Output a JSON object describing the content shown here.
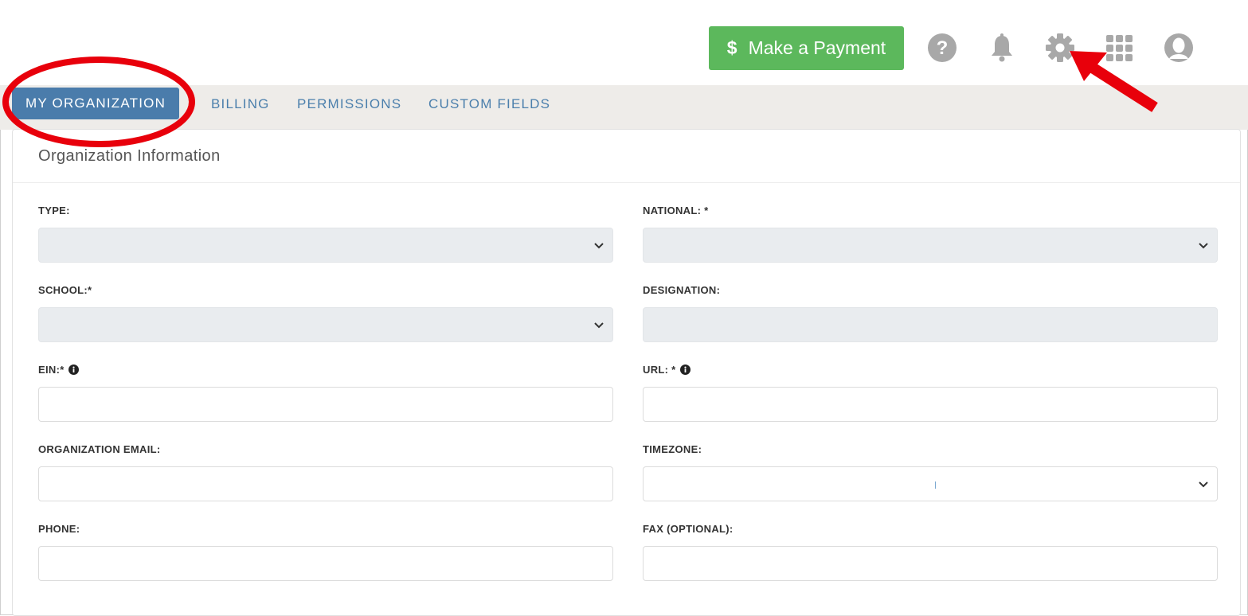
{
  "header": {
    "payment_button": {
      "label": "Make a Payment",
      "icon": "dollar-icon"
    },
    "icons": [
      "help-icon",
      "bell-icon",
      "gear-icon",
      "apps-grid-icon",
      "user-avatar-icon"
    ]
  },
  "tabs": [
    {
      "label": "MY ORGANIZATION",
      "active": true
    },
    {
      "label": "BILLING",
      "active": false
    },
    {
      "label": "PERMISSIONS",
      "active": false
    },
    {
      "label": "CUSTOM FIELDS",
      "active": false
    }
  ],
  "form": {
    "title": "Organization Information",
    "fields": {
      "type": {
        "label": "TYPE:",
        "value": ""
      },
      "national": {
        "label": "NATIONAL: *",
        "value": ""
      },
      "school": {
        "label": "SCHOOL:*",
        "value": ""
      },
      "designation": {
        "label": "DESIGNATION:",
        "value": ""
      },
      "ein": {
        "label": "EIN:*",
        "value": ""
      },
      "url": {
        "label": "URL: *",
        "value": ""
      },
      "org_email": {
        "label": "ORGANIZATION EMAIL:",
        "value": ""
      },
      "timezone": {
        "label": "TIMEZONE:",
        "value": ""
      },
      "phone": {
        "label": "PHONE:",
        "value": ""
      },
      "fax": {
        "label": "FAX (OPTIONAL):",
        "value": ""
      }
    }
  },
  "colors": {
    "primary_blue": "#4a7cab",
    "tab_text": "#4b7fac",
    "success_green": "#5cb85c",
    "annotation_red": "#e8000b",
    "icon_gray": "#a8a8a8"
  }
}
